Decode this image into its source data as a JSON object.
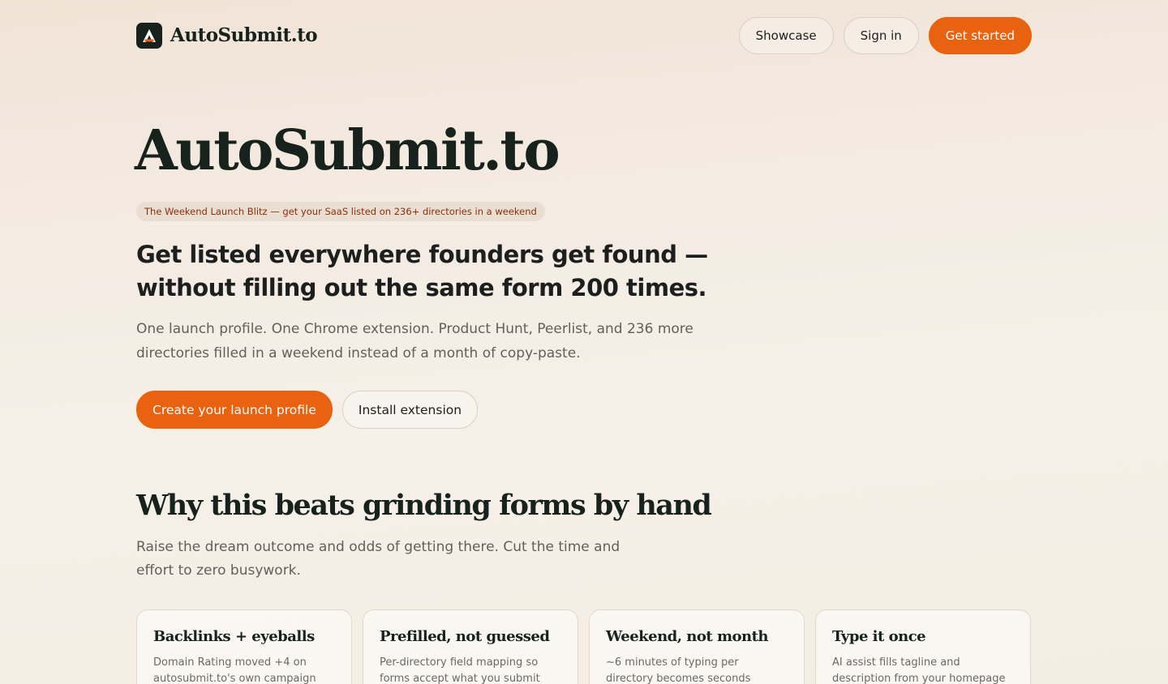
{
  "header": {
    "brand_name": "AutoSubmit.to",
    "nav": {
      "showcase": "Showcase",
      "sign_in": "Sign in",
      "get_started": "Get started"
    }
  },
  "hero": {
    "title": "AutoSubmit.to",
    "tag": "The Weekend Launch Blitz — get your SaaS listed on 236+ directories in a weekend",
    "subhead": "Get listed everywhere founders get found — without filling out the same form 200 times.",
    "lede": "One launch profile. One Chrome extension. Product Hunt, Peerlist, and 236 more directories filled in a weekend instead of a month of copy-paste.",
    "primary_cta": "Create your launch profile",
    "secondary_cta": "Install extension"
  },
  "why": {
    "title": "Why this beats grinding forms by hand",
    "subtitle": "Raise the dream outcome and odds of getting there. Cut the time and effort to zero busywork.",
    "cards": [
      {
        "title": "Backlinks + eyeballs",
        "body": "Domain Rating moved +4 on autosubmit.to's own campaign"
      },
      {
        "title": "Prefilled, not guessed",
        "body": "Per-directory field mapping so forms accept what you submit"
      },
      {
        "title": "Weekend, not month",
        "body": "~6 minutes of typing per directory becomes seconds"
      },
      {
        "title": "Type it once",
        "body": "AI assist fills tagline and description from your homepage"
      }
    ]
  },
  "colors": {
    "accent": "#e8620f",
    "ink": "#17221d",
    "tag_text": "#8a2f0c",
    "tag_bg": "#eaded2"
  }
}
